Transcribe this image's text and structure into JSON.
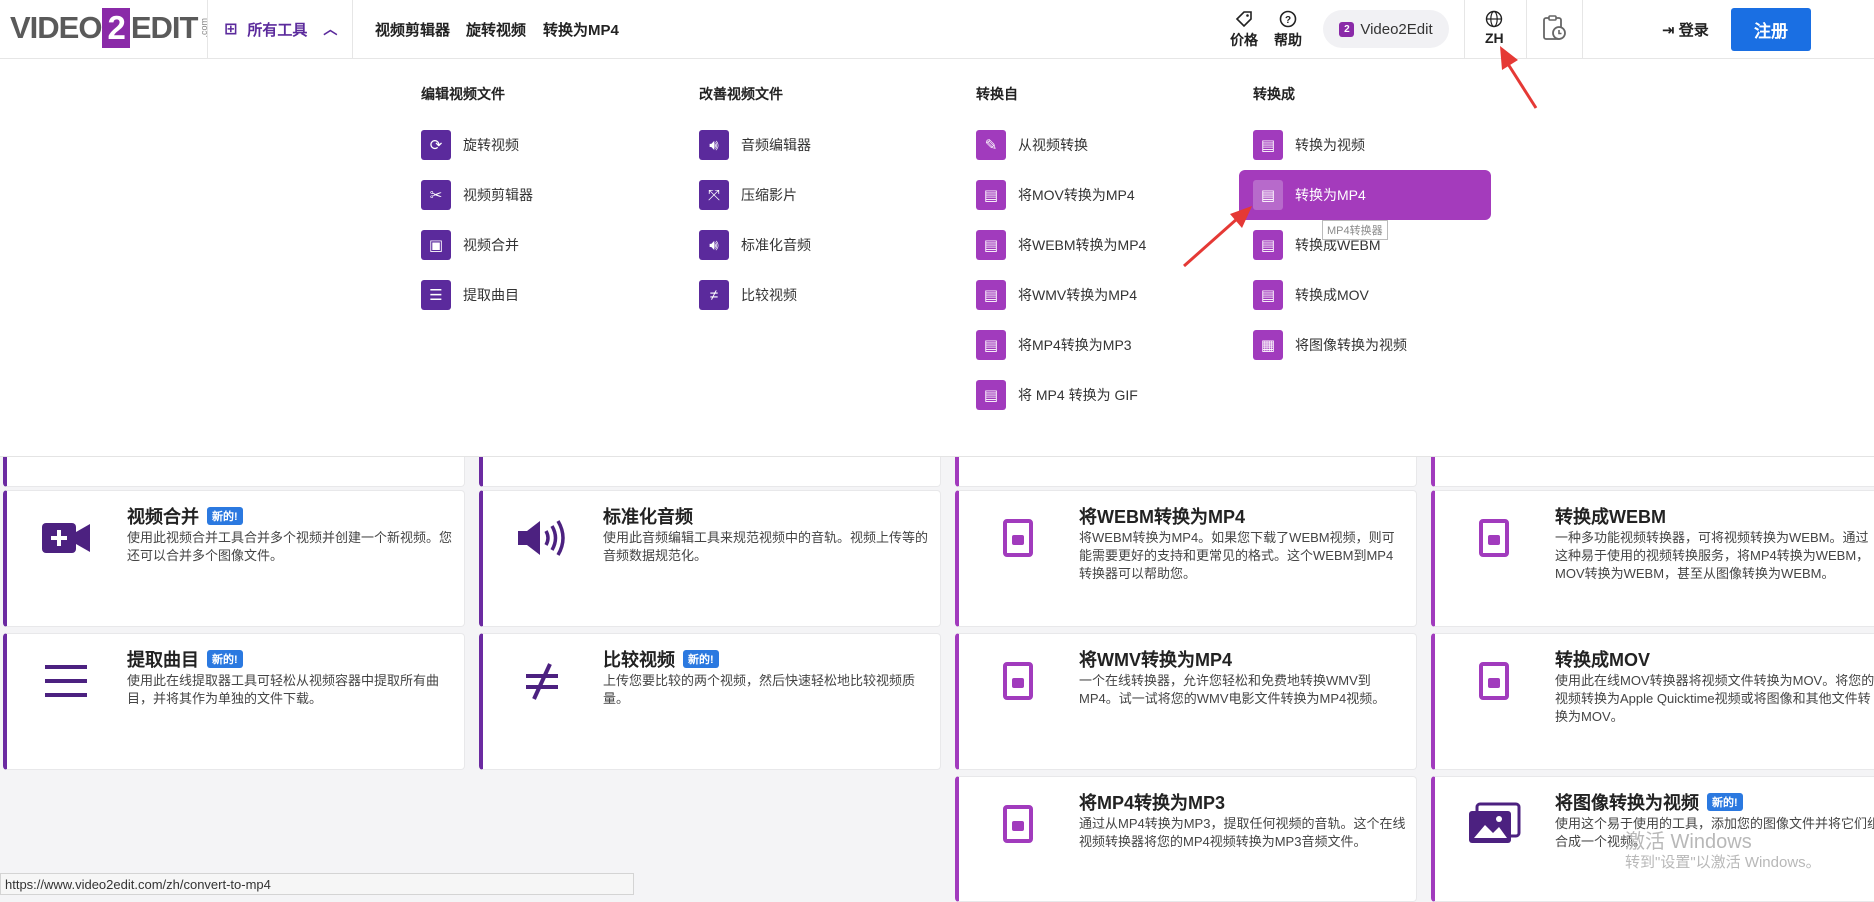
{
  "header": {
    "logo": {
      "left": "VIDEO",
      "mid": "2",
      "right": "EDIT",
      "suffix": ".com"
    },
    "all_tools": "所有工具",
    "nav": [
      "视频剪辑器",
      "旋转视频",
      "转换为MP4"
    ],
    "price": "价格",
    "help": "帮助",
    "product_pill": "Video2Edit",
    "language": "ZH",
    "login": "登录",
    "register": "注册"
  },
  "menu": {
    "col1": {
      "title": "编辑视频文件",
      "items": [
        "旋转视频",
        "视频剪辑器",
        "视频合并",
        "提取曲目"
      ]
    },
    "col2": {
      "title": "改善视频文件",
      "items": [
        "音频编辑器",
        "压缩影片",
        "标准化音频",
        "比较视频"
      ]
    },
    "col3": {
      "title": "转换自",
      "items": [
        "从视频转换",
        "将MOV转换为MP4",
        "将WEBM转换为MP4",
        "将WMV转换为MP4",
        "将MP4转换为MP3",
        "将 MP4 转换为 GIF"
      ]
    },
    "col4": {
      "title": "转换成",
      "items": [
        "转换为视频",
        "转换为MP4",
        "转换成WEBM",
        "转换成MOV",
        "将图像转换为视频"
      ]
    },
    "tooltip": "MP4转换器"
  },
  "cards": [
    {
      "title": "视频合并",
      "badge": "新的!",
      "desc": "使用此视频合并工具合并多个视频并创建一个新视频。您还可以合并多个图像文件。"
    },
    {
      "title": "标准化音频",
      "badge": "",
      "desc": "使用此音频编辑工具来规范视频中的音轨。视频上传等的音频数据规范化。"
    },
    {
      "title": "将WEBM转换为MP4",
      "badge": "",
      "desc": "将WEBM转换为MP4。如果您下载了WEBM视频，则可能需要更好的支持和更常见的格式。这个WEBM到MP4转换器可以帮助您。"
    },
    {
      "title": "转换成WEBM",
      "badge": "",
      "desc": "一种多功能视频转换器，可将视频转换为WEBM。通过这种易于使用的视频转换服务，将MP4转换为WEBM，MOV转换为WEBM，甚至从图像转换为WEBM。"
    },
    {
      "title": "提取曲目",
      "badge": "新的!",
      "desc": "使用此在线提取器工具可轻松从视频容器中提取所有曲目，并将其作为单独的文件下载。"
    },
    {
      "title": "比较视频",
      "badge": "新的!",
      "desc": "上传您要比较的两个视频，然后快速轻松地比较视频质量。"
    },
    {
      "title": "将WMV转换为MP4",
      "badge": "",
      "desc": "一个在线转换器，允许您轻松和免费地转换WMV到MP4。试一试将您的WMV电影文件转换为MP4视频。"
    },
    {
      "title": "转换成MOV",
      "badge": "",
      "desc": "使用此在线MOV转换器将视频文件转换为MOV。将您的视频转换为Apple Quicktime视频或将图像和其他文件转换为MOV。"
    },
    {
      "title": "将MP4转换为MP3",
      "badge": "",
      "desc": "通过从MP4转换为MP3，提取任何视频的音轨。这个在线视频转换器将您的MP4视频转换为MP3音频文件。"
    },
    {
      "title": "将图像转换为视频",
      "badge": "新的!",
      "desc": "使用这个易于使用的工具，添加您的图像文件并将它们组合成一个视频。"
    }
  ],
  "status_url": "https://www.video2edit.com/zh/convert-to-mp4",
  "watermark": {
    "line1": "激活 Windows",
    "line2": "转到\"设置\"以激活 Windows。"
  },
  "colors": {
    "brand_purple": "#5b2a9c",
    "magenta": "#a13bbd",
    "register_blue": "#1a6fe3",
    "badge_blue": "#2b79e0",
    "annotation_red": "#e53935"
  }
}
